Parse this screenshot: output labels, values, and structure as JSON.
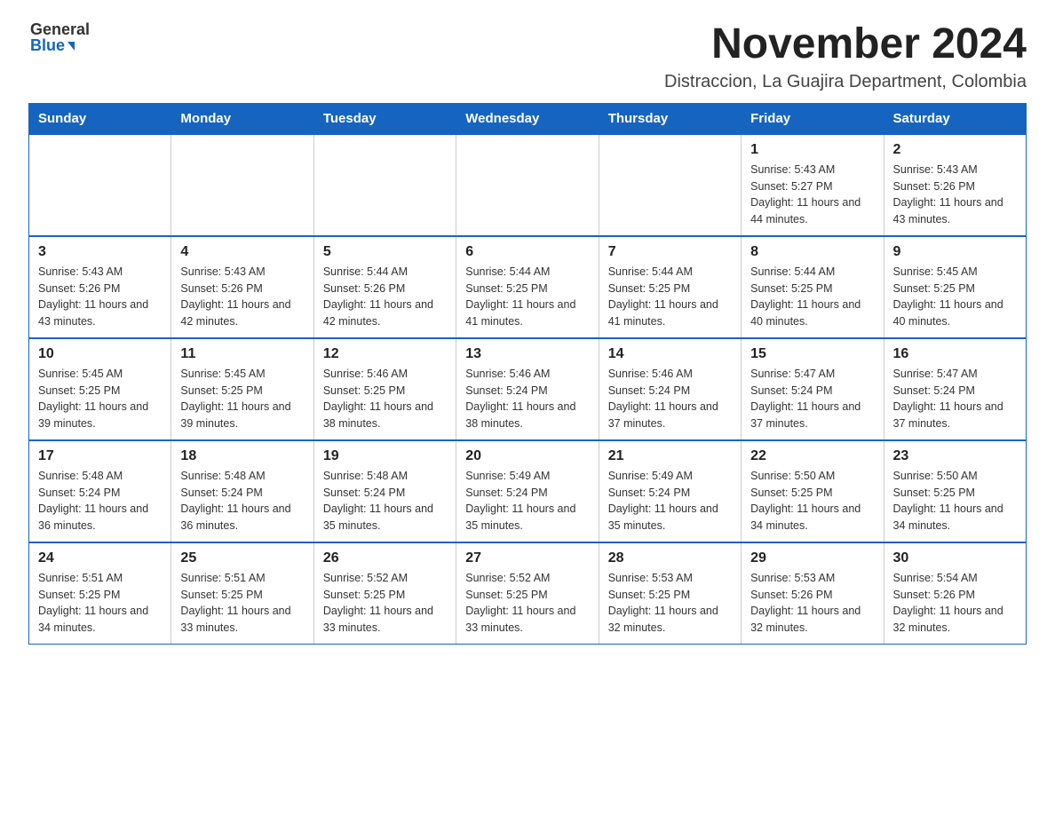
{
  "header": {
    "logo_general": "General",
    "logo_blue": "Blue",
    "month_title": "November 2024",
    "subtitle": "Distraccion, La Guajira Department, Colombia"
  },
  "calendar": {
    "days_of_week": [
      "Sunday",
      "Monday",
      "Tuesday",
      "Wednesday",
      "Thursday",
      "Friday",
      "Saturday"
    ],
    "weeks": [
      [
        {
          "day": "",
          "info": ""
        },
        {
          "day": "",
          "info": ""
        },
        {
          "day": "",
          "info": ""
        },
        {
          "day": "",
          "info": ""
        },
        {
          "day": "",
          "info": ""
        },
        {
          "day": "1",
          "info": "Sunrise: 5:43 AM\nSunset: 5:27 PM\nDaylight: 11 hours and 44 minutes."
        },
        {
          "day": "2",
          "info": "Sunrise: 5:43 AM\nSunset: 5:26 PM\nDaylight: 11 hours and 43 minutes."
        }
      ],
      [
        {
          "day": "3",
          "info": "Sunrise: 5:43 AM\nSunset: 5:26 PM\nDaylight: 11 hours and 43 minutes."
        },
        {
          "day": "4",
          "info": "Sunrise: 5:43 AM\nSunset: 5:26 PM\nDaylight: 11 hours and 42 minutes."
        },
        {
          "day": "5",
          "info": "Sunrise: 5:44 AM\nSunset: 5:26 PM\nDaylight: 11 hours and 42 minutes."
        },
        {
          "day": "6",
          "info": "Sunrise: 5:44 AM\nSunset: 5:25 PM\nDaylight: 11 hours and 41 minutes."
        },
        {
          "day": "7",
          "info": "Sunrise: 5:44 AM\nSunset: 5:25 PM\nDaylight: 11 hours and 41 minutes."
        },
        {
          "day": "8",
          "info": "Sunrise: 5:44 AM\nSunset: 5:25 PM\nDaylight: 11 hours and 40 minutes."
        },
        {
          "day": "9",
          "info": "Sunrise: 5:45 AM\nSunset: 5:25 PM\nDaylight: 11 hours and 40 minutes."
        }
      ],
      [
        {
          "day": "10",
          "info": "Sunrise: 5:45 AM\nSunset: 5:25 PM\nDaylight: 11 hours and 39 minutes."
        },
        {
          "day": "11",
          "info": "Sunrise: 5:45 AM\nSunset: 5:25 PM\nDaylight: 11 hours and 39 minutes."
        },
        {
          "day": "12",
          "info": "Sunrise: 5:46 AM\nSunset: 5:25 PM\nDaylight: 11 hours and 38 minutes."
        },
        {
          "day": "13",
          "info": "Sunrise: 5:46 AM\nSunset: 5:24 PM\nDaylight: 11 hours and 38 minutes."
        },
        {
          "day": "14",
          "info": "Sunrise: 5:46 AM\nSunset: 5:24 PM\nDaylight: 11 hours and 37 minutes."
        },
        {
          "day": "15",
          "info": "Sunrise: 5:47 AM\nSunset: 5:24 PM\nDaylight: 11 hours and 37 minutes."
        },
        {
          "day": "16",
          "info": "Sunrise: 5:47 AM\nSunset: 5:24 PM\nDaylight: 11 hours and 37 minutes."
        }
      ],
      [
        {
          "day": "17",
          "info": "Sunrise: 5:48 AM\nSunset: 5:24 PM\nDaylight: 11 hours and 36 minutes."
        },
        {
          "day": "18",
          "info": "Sunrise: 5:48 AM\nSunset: 5:24 PM\nDaylight: 11 hours and 36 minutes."
        },
        {
          "day": "19",
          "info": "Sunrise: 5:48 AM\nSunset: 5:24 PM\nDaylight: 11 hours and 35 minutes."
        },
        {
          "day": "20",
          "info": "Sunrise: 5:49 AM\nSunset: 5:24 PM\nDaylight: 11 hours and 35 minutes."
        },
        {
          "day": "21",
          "info": "Sunrise: 5:49 AM\nSunset: 5:24 PM\nDaylight: 11 hours and 35 minutes."
        },
        {
          "day": "22",
          "info": "Sunrise: 5:50 AM\nSunset: 5:25 PM\nDaylight: 11 hours and 34 minutes."
        },
        {
          "day": "23",
          "info": "Sunrise: 5:50 AM\nSunset: 5:25 PM\nDaylight: 11 hours and 34 minutes."
        }
      ],
      [
        {
          "day": "24",
          "info": "Sunrise: 5:51 AM\nSunset: 5:25 PM\nDaylight: 11 hours and 34 minutes."
        },
        {
          "day": "25",
          "info": "Sunrise: 5:51 AM\nSunset: 5:25 PM\nDaylight: 11 hours and 33 minutes."
        },
        {
          "day": "26",
          "info": "Sunrise: 5:52 AM\nSunset: 5:25 PM\nDaylight: 11 hours and 33 minutes."
        },
        {
          "day": "27",
          "info": "Sunrise: 5:52 AM\nSunset: 5:25 PM\nDaylight: 11 hours and 33 minutes."
        },
        {
          "day": "28",
          "info": "Sunrise: 5:53 AM\nSunset: 5:25 PM\nDaylight: 11 hours and 32 minutes."
        },
        {
          "day": "29",
          "info": "Sunrise: 5:53 AM\nSunset: 5:26 PM\nDaylight: 11 hours and 32 minutes."
        },
        {
          "day": "30",
          "info": "Sunrise: 5:54 AM\nSunset: 5:26 PM\nDaylight: 11 hours and 32 minutes."
        }
      ]
    ]
  }
}
